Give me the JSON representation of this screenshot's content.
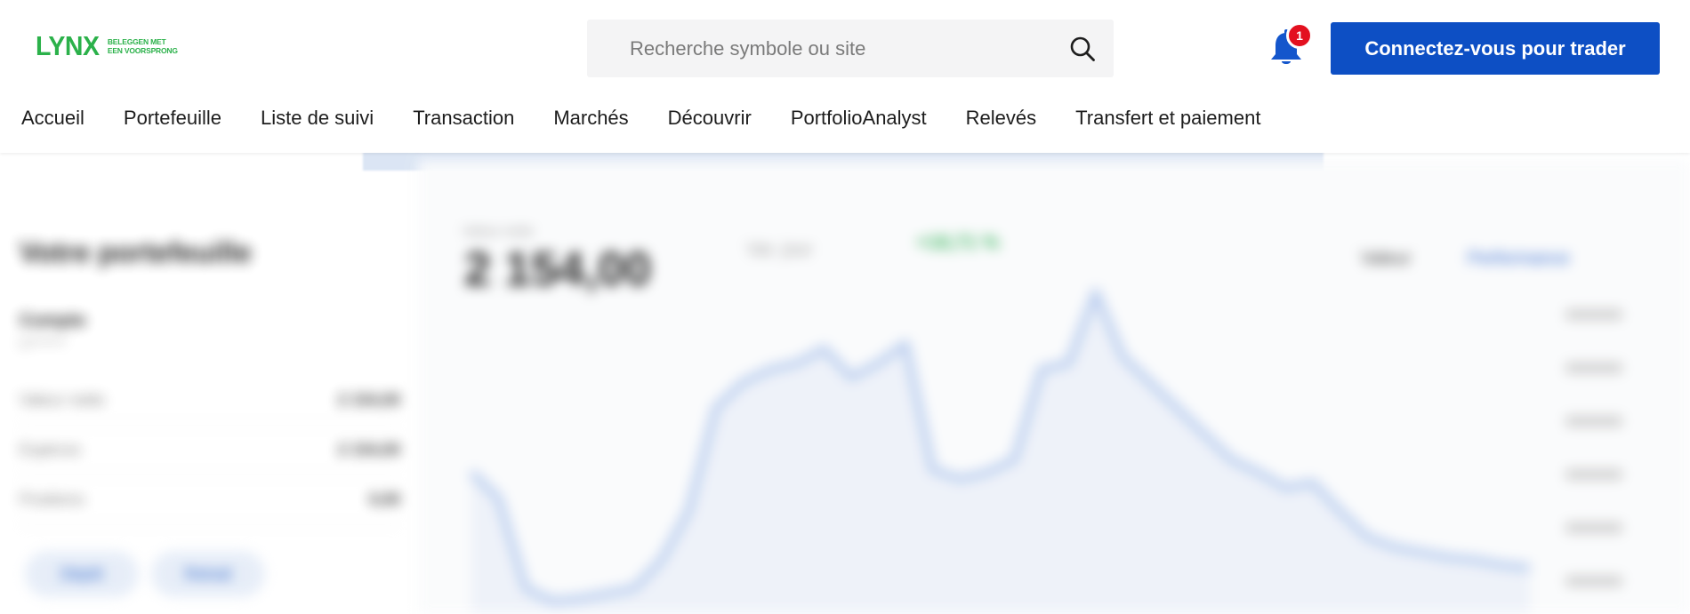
{
  "brand": {
    "name": "LYNX",
    "tagline_line1": "BELEGGEN MET",
    "tagline_line2": "EEN VOORSPRONG",
    "color": "#2bb14a"
  },
  "search": {
    "placeholder": "Recherche symbole ou site",
    "icon": "search-icon"
  },
  "notifications": {
    "icon": "bell-icon",
    "count": "1",
    "badge_color": "#e3101f"
  },
  "login_button": {
    "label": "Connectez-vous pour trader",
    "color": "#0d4fc4"
  },
  "nav": {
    "items": [
      {
        "label": "Accueil"
      },
      {
        "label": "Portefeuille"
      },
      {
        "label": "Liste de suivi"
      },
      {
        "label": "Transaction"
      },
      {
        "label": "Marchés"
      },
      {
        "label": "Découvrir"
      },
      {
        "label": "PortfolioAnalyst"
      },
      {
        "label": "Relevés"
      },
      {
        "label": "Transfert et paiement"
      }
    ]
  },
  "portfolio_preview": {
    "title": "Votre portefeuille",
    "account_label": "Compte",
    "account_sub": "U*******",
    "rows": [
      {
        "label": "Valeur nette",
        "value": "2 154,00"
      },
      {
        "label": "Espèces",
        "value": "2 154,00"
      },
      {
        "label": "Positions",
        "value": "0,00"
      }
    ],
    "buttons": [
      "Dépôt",
      "Retrait"
    ],
    "value_label": "Valeur nette",
    "value": "2 154,00",
    "metric_a": "Var. jour",
    "metric_b": "+18,71 %",
    "controls": [
      "Valeur",
      "Performance"
    ],
    "line_color": "#b9cdef"
  },
  "chart_data": {
    "type": "area",
    "x": [
      0,
      1,
      2,
      3,
      4,
      5,
      6,
      7,
      8,
      9,
      10,
      11,
      12,
      13,
      14,
      15,
      16,
      17,
      18,
      19,
      20,
      21,
      22,
      23,
      24,
      25,
      26,
      27,
      28,
      29,
      30,
      31,
      32,
      33,
      34,
      35,
      36,
      37,
      38,
      39
    ],
    "values": [
      330,
      310,
      240,
      230,
      232,
      236,
      240,
      262,
      300,
      380,
      400,
      410,
      415,
      426,
      404,
      415,
      430,
      332,
      325,
      330,
      340,
      410,
      415,
      470,
      420,
      400,
      380,
      360,
      340,
      330,
      318,
      322,
      300,
      280,
      272,
      268,
      264,
      262,
      258,
      256
    ],
    "ylim": [
      220,
      490
    ]
  }
}
